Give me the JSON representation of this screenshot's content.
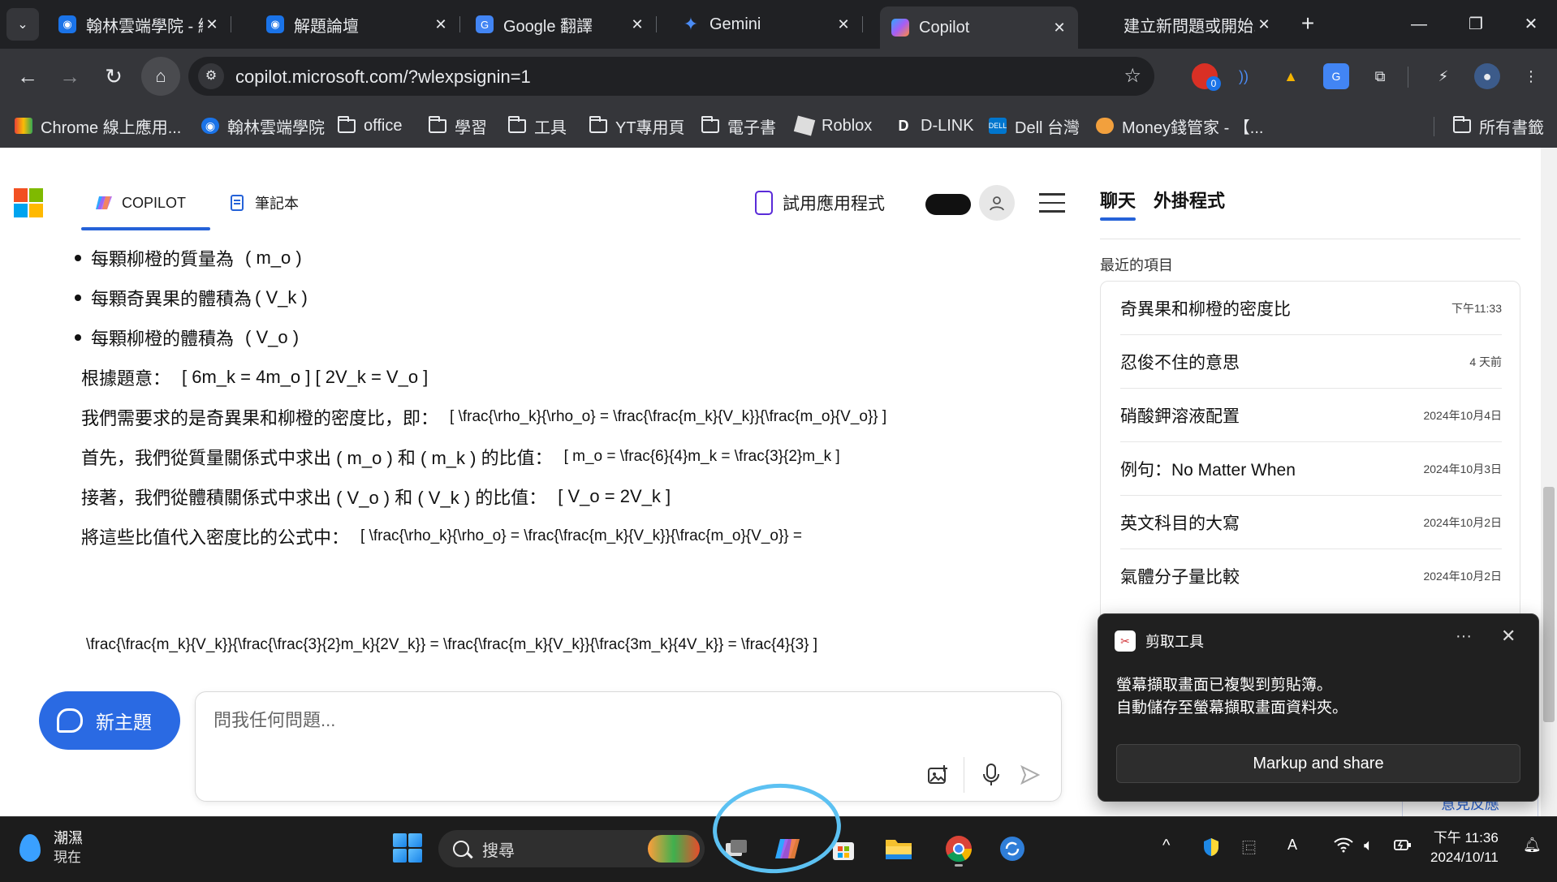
{
  "browser": {
    "tabs": [
      {
        "label": "翰林雲端學院 - 線...",
        "color": "#1a73e8"
      },
      {
        "label": "解題論壇",
        "color": "#1a73e8"
      },
      {
        "label": "Google 翻譯",
        "color": "#4285f4"
      },
      {
        "label": "Gemini",
        "color": "#4b8cf5"
      },
      {
        "label": "Copilot",
        "color": "#8a5cf5"
      },
      {
        "label": "建立新問題或開始...",
        "color": "#f25022"
      }
    ],
    "url": "copilot.microsoft.com/?wlexpsignin=1",
    "extension_badge": "0",
    "bookmarks": [
      "Chrome 線上應用...",
      "翰林雲端學院",
      "office",
      "學習",
      "工具",
      "YT專用頁",
      "電子書",
      "Roblox",
      "D-LINK",
      "Dell 台灣",
      "Money錢管家 - 【...",
      "所有書籤"
    ]
  },
  "copilot": {
    "tab_copilot": "COPILOT",
    "tab_notebook": "筆記本",
    "try_app": "試用應用程式",
    "bullets": [
      {
        "prefix": "每顆柳橙的質量為",
        "expr": "( m_o )"
      },
      {
        "prefix": "每顆奇異果的體積為",
        "expr": "( V_k )"
      },
      {
        "prefix": "每顆柳橙的體積為",
        "expr": "( V_o )"
      }
    ],
    "paragraphs": [
      {
        "prefix": "根據題意：",
        "expr": "[ 6m_k = 4m_o ] [ 2V_k = V_o ]"
      },
      {
        "prefix": "我們需要求的是奇異果和柳橙的密度比，即：",
        "expr": "[ \\frac{\\rho_k}{\\rho_o} = \\frac{\\frac{m_k}{V_k}}{\\frac{m_o}{V_o}} ]"
      },
      {
        "prefix": "首先，我們從質量關係式中求出 ( m_o ) 和 ( m_k ) 的比值：",
        "expr": "[ m_o = \\frac{6}{4}m_k = \\frac{3}{2}m_k ]"
      },
      {
        "prefix": "接著，我們從體積關係式中求出 ( V_o ) 和 ( V_k ) 的比值：",
        "expr": "[ V_o = 2V_k ]"
      },
      {
        "prefix": "將這些比值代入密度比的公式中：",
        "expr": "[ \\frac{\\rho_k}{\\rho_o} = \\frac{\\frac{m_k}{V_k}}{\\frac{m_o}{V_o}} ="
      }
    ],
    "final_line": "\\frac{\\frac{m_k}{V_k}}{\\frac{\\frac{3}{2}m_k}{2V_k}} = \\frac{\\frac{m_k}{V_k}}{\\frac{3m_k}{4V_k}} = \\frac{4}{3} ]",
    "new_topic": "新主題",
    "ask_placeholder": "問我任何問題...",
    "sidebar": {
      "tab_chat": "聊天",
      "tab_plugins": "外掛程式",
      "recent_heading": "最近的項目",
      "recent_items": [
        {
          "title": "奇異果和柳橙的密度比",
          "date": "下午11:33"
        },
        {
          "title": "忍俊不住的意思",
          "date": "4 天前"
        },
        {
          "title": "硝酸鉀溶液配置",
          "date": "2024年10月4日"
        },
        {
          "title": "例句：No Matter When",
          "date": "2024年10月3日"
        },
        {
          "title": "英文科目的大寫",
          "date": "2024年10月2日"
        },
        {
          "title": "氣體分子量比較",
          "date": "2024年10月2日"
        }
      ],
      "feedback": "意見反應"
    }
  },
  "toast": {
    "app_name": "剪取工具",
    "more": "···",
    "line1": "螢幕擷取畫面已複製到剪貼簿。",
    "line2": "自動儲存至螢幕擷取畫面資料夾。",
    "button": "Markup and share"
  },
  "taskbar": {
    "weather_label": "潮濕",
    "weather_sub": "現在",
    "search_label": "搜尋",
    "time": "下午 11:36",
    "date": "2024/10/11",
    "ime": "A"
  },
  "colors": {
    "highlight": "#ff5a10",
    "accent": "#2562d8",
    "new_topic_bg": "#2a6ae3",
    "circle_mark": "#5cc1f2"
  }
}
